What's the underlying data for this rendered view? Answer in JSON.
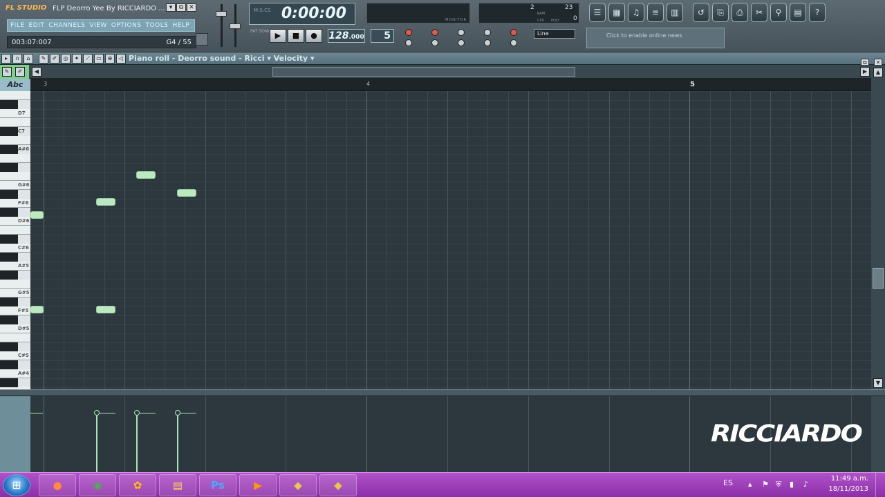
{
  "app": {
    "logo": "FL STUDIO",
    "title": "FLP Deorro Yee By RICCIARDO ...",
    "window_buttons": [
      "▾",
      "⧉",
      "✕"
    ]
  },
  "menu": [
    "FILE",
    "EDIT",
    "CHANNELS",
    "VIEW",
    "OPTIONS",
    "TOOLS",
    "HELP"
  ],
  "hint": {
    "time": "003:07:007",
    "note": "G4 / 55"
  },
  "transport": {
    "time": "0:00:00",
    "time_label": "M:S:CS",
    "play": "▶",
    "stop": "■",
    "record": "●",
    "tempo_int": "128",
    "tempo_dec": ".000",
    "pattern": "5",
    "pat_song": "PAT SONG"
  },
  "monitor": {
    "label": "MONITOR"
  },
  "cpu": {
    "val1": "2",
    "val2": "23",
    "val3": "0",
    "ram": "RAM",
    "cpu": "CPU",
    "poly": "POLY"
  },
  "snap": {
    "value": "Line"
  },
  "news": {
    "text": "Click to enable online news"
  },
  "piano_roll": {
    "title": "Piano roll - Deorro sound - Ricci",
    "target": "Velocity",
    "abc": "Abc",
    "ruler": [
      {
        "label": "3",
        "big": false
      },
      {
        "label": "4",
        "big": false
      },
      {
        "label": "5",
        "big": true
      }
    ],
    "win_buttons": [
      "⧉",
      "✕"
    ]
  },
  "keys": [
    "D7",
    "C7",
    "A#6",
    "G#6",
    "F#6",
    "D#6",
    "C#6",
    "A#5",
    "G#5",
    "F#5",
    "D#5",
    "C#5",
    "A#4"
  ],
  "watermark": "RICCIARDO",
  "taskbar": {
    "apps": [
      "Firefox",
      "Chrome",
      "FL",
      "Explorer",
      "Ps",
      "Media",
      "FL2",
      "FL3"
    ],
    "lang": "ES",
    "time": "11:49 a.m.",
    "date": "18/11/2013"
  },
  "colors": {
    "note": "#bde8c2",
    "grid_bg": "#2d383e",
    "taskbar": "#a040bc"
  }
}
